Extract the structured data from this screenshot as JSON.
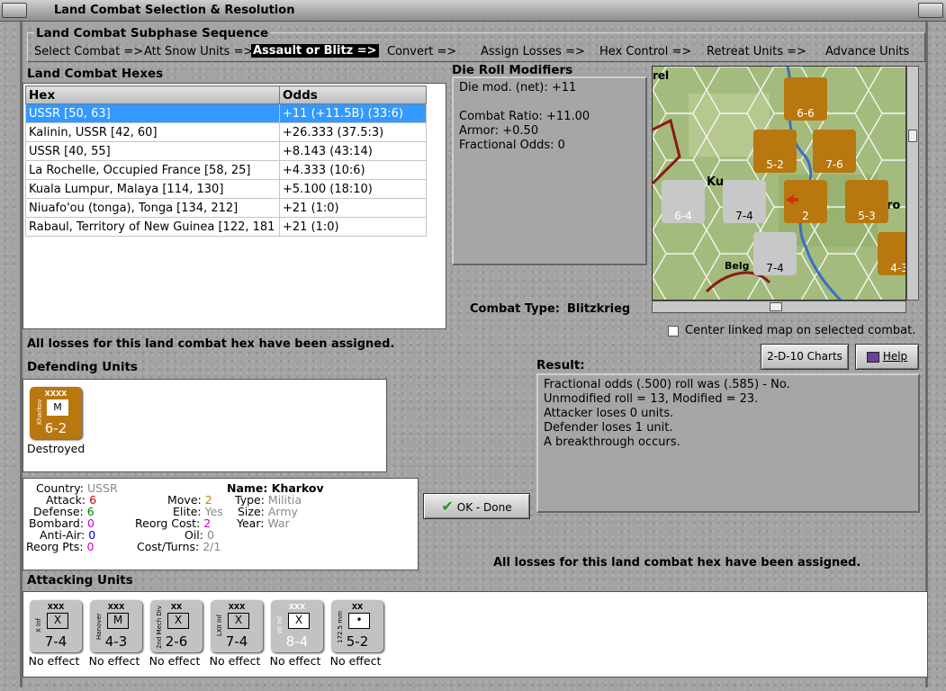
{
  "window": {
    "title": "Land Combat Selection & Resolution"
  },
  "sequence": {
    "title": "Land Combat Subphase Sequence",
    "steps": [
      "Select Combat =>",
      "Att Snow Units =>",
      "Assault or Blitz =>",
      "Convert =>",
      "Assign Losses =>",
      "Hex Control =>",
      "Retreat Units =>",
      "Advance Units"
    ],
    "active_index": 2
  },
  "hexes": {
    "title": "Land Combat Hexes",
    "columns": [
      "Hex",
      "Odds"
    ],
    "rows": [
      {
        "hex": "USSR [50, 63]",
        "odds": "+11 (+11.5B) (33:6)"
      },
      {
        "hex": "Kalinin, USSR [42, 60]",
        "odds": "+26.333 (37.5:3)"
      },
      {
        "hex": "USSR [40, 55]",
        "odds": "+8.143 (43:14)"
      },
      {
        "hex": "La Rochelle, Occupied France [58, 25]",
        "odds": "+4.333 (10:6)"
      },
      {
        "hex": "Kuala Lumpur, Malaya [114, 130]",
        "odds": "+5.100 (18:10)"
      },
      {
        "hex": "Niuafo'ou (tonga), Tonga [134, 212]",
        "odds": "+21 (1:0)"
      },
      {
        "hex": "Rabaul, Territory of New Guinea [122, 181",
        "odds": "+21 (1:0)"
      }
    ]
  },
  "modifiers": {
    "title": "Die Roll Modifiers",
    "lines": [
      "Die mod. (net): +11",
      "",
      "Combat Ratio: +11.00",
      "Armor: +0.50",
      "Fractional Odds: 0"
    ]
  },
  "combat_type": {
    "label": "Combat Type:",
    "value": "Blitzkrieg"
  },
  "center_map_label": "Center linked map on selected combat.",
  "losses_msg": "All losses for this land combat hex have been assigned.",
  "buttons": {
    "charts": "2-D-10 Charts",
    "help": "Help",
    "ok": "OK - Done"
  },
  "result": {
    "title": "Result:",
    "lines": [
      "Fractional odds (.500) roll was (.585)  - No.",
      "Unmodified roll = 13, Modified = 23.",
      "Attacker loses 0 units.",
      "Defender loses 1 unit.",
      "A breakthrough occurs."
    ]
  },
  "defending": {
    "title": "Defending Units",
    "units": [
      {
        "name": "Kharkov",
        "size": "XXXX",
        "symbol": "M",
        "strength": "6-2",
        "status": "Destroyed",
        "color": "#b8770f"
      }
    ]
  },
  "unit_info": {
    "country_l": "Country:",
    "country": "USSR",
    "attack_l": "Attack:",
    "attack": "6",
    "defense_l": "Defense:",
    "defense": "6",
    "bombard_l": "Bombard:",
    "bombard": "0",
    "antiair_l": "Anti-Air:",
    "antiair": "0",
    "reorgpts_l": "Reorg Pts:",
    "reorgpts": "0",
    "move_l": "Move:",
    "move": "2",
    "elite_l": "Elite:",
    "elite": "Yes",
    "reorgcost_l": "Reorg Cost:",
    "reorgcost": "2",
    "oil_l": "Oil:",
    "oil": "0",
    "costturns_l": "Cost/Turns:",
    "costturns": "2/1",
    "name_l": "Name:",
    "name": "Kharkov",
    "type_l": "Type:",
    "type": "Militia",
    "size_l": "Size:",
    "size": "Army",
    "year_l": "Year:",
    "year": "War"
  },
  "attacking": {
    "title": "Attacking Units",
    "units": [
      {
        "name": "X Inf",
        "size": "XXX",
        "symbol": "X",
        "strength": "7-4",
        "status": "No effect"
      },
      {
        "name": "Hanover",
        "size": "XXX",
        "symbol": "M",
        "strength": "4-3",
        "status": "No effect"
      },
      {
        "name": "2nd Mech Div",
        "size": "XX",
        "symbol": "X",
        "strength": "2-6",
        "status": "No effect"
      },
      {
        "name": "LXII Inf",
        "size": "XXX",
        "symbol": "X",
        "strength": "7-4",
        "status": "No effect"
      },
      {
        "name": "VII Inf",
        "size": "XXX",
        "symbol": "X",
        "strength": "8-4",
        "status": "No effect"
      },
      {
        "name": "172.5 mm",
        "size": "XX",
        "symbol": "•",
        "strength": "5-2",
        "status": "No effect"
      }
    ]
  },
  "map": {
    "labels": [
      "rel",
      "Ku",
      "ro",
      "Belg"
    ],
    "counters": [
      {
        "strength": "6-6",
        "size": "XXX"
      },
      {
        "strength": "6-6",
        "size": "XXX"
      },
      {
        "strength": "5-2",
        "size": "XXXX"
      },
      {
        "strength": "7-6",
        "size": "XXX"
      },
      {
        "strength": "6-4",
        "size": "XXX"
      },
      {
        "strength": "7-4",
        "size": "XXX"
      },
      {
        "strength": "2",
        "size": "XXXX"
      },
      {
        "strength": "5-3",
        "size": "XXX"
      },
      {
        "strength": "7-4",
        "size": "XXX"
      },
      {
        "strength": "4-3",
        "size": "XXX"
      }
    ]
  },
  "colors": {
    "selection": "#3399ff",
    "german_counter": "#c0c0c0",
    "soviet_counter": "#b8770f",
    "attack_red": "#cc0000",
    "defense_green": "#008800",
    "bombard_magenta": "#cc00cc",
    "antiair_blue": "#0000cc"
  }
}
